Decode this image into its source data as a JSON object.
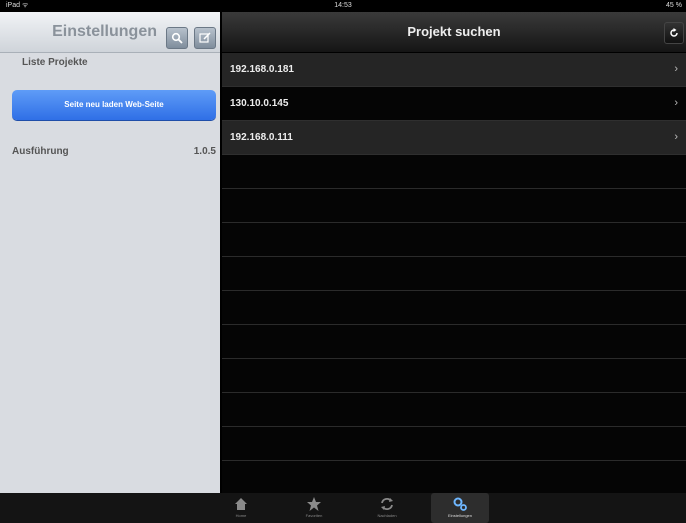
{
  "status_bar": {
    "left": "iPad ᯤ",
    "time": "14:53",
    "battery": "45 %"
  },
  "settings": {
    "title": "Einstellungen",
    "project_list_label": "Liste Projekte",
    "reload_button": "Seite neu laden Web-Seite",
    "version_label": "Ausführung",
    "version_value": "1.0.5"
  },
  "search": {
    "title": "Projekt suchen",
    "rows": [
      {
        "label": "192.168.0.181",
        "chevron": "›"
      },
      {
        "label": "130.10.0.145",
        "chevron": "›"
      },
      {
        "label": "192.168.0.111",
        "chevron": "›"
      }
    ]
  },
  "tabbar": {
    "tabs": [
      {
        "label": "Home",
        "icon": "home-icon"
      },
      {
        "label": "Favoriten",
        "icon": "star-icon"
      },
      {
        "label": "Nachladen",
        "icon": "sync-icon"
      },
      {
        "label": "Einstellungen",
        "icon": "gears-icon",
        "active": true
      }
    ]
  }
}
